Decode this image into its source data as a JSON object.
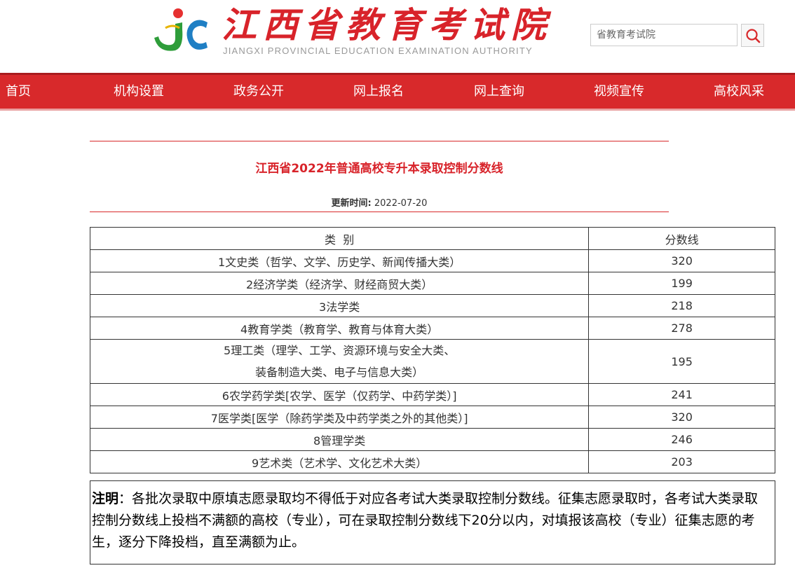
{
  "header": {
    "title_cn": "江西省教育考试院",
    "title_en": "JIANGXI PROVINCIAL EDUCATION EXAMINATION AUTHORITY",
    "logo_icon": "jx-logo-icon",
    "search": {
      "placeholder": "省教育考试院",
      "icon": "search-icon"
    }
  },
  "nav": {
    "items": [
      {
        "label": "首页"
      },
      {
        "label": "机构设置"
      },
      {
        "label": "政务公开"
      },
      {
        "label": "网上报名"
      },
      {
        "label": "网上查询"
      },
      {
        "label": "视频宣传"
      },
      {
        "label": "高校风采"
      }
    ]
  },
  "article": {
    "title": "江西省2022年普通高校专升本录取控制分数线",
    "update_label": "更新时间:",
    "update_date": "2022-07-20"
  },
  "table": {
    "headers": [
      "类  别",
      "分数线"
    ],
    "rows": [
      {
        "category": "1文史类（哲学、文学、历史学、新闻传播大类）",
        "score": "320"
      },
      {
        "category": "2经济学类（经济学、财经商贸大类）",
        "score": "199"
      },
      {
        "category": "3法学类",
        "score": "218"
      },
      {
        "category": "4教育学类（教育学、教育与体育大类）",
        "score": "278"
      },
      {
        "category": "5理工类（理学、工学、资源环境与安全大类、",
        "category_line2": "装备制造大类、电子与信息大类）",
        "score": "195"
      },
      {
        "category": "6农学药学类[农学、医学（仅药学、中药学类）]",
        "score": "241"
      },
      {
        "category": "7医学类[医学（除药学类及中药学类之外的其他类）]",
        "score": "320"
      },
      {
        "category": "8管理学类",
        "score": "246"
      },
      {
        "category": "9艺术类（艺术学、文化艺术大类）",
        "score": "203"
      }
    ]
  },
  "note": {
    "label": "注明",
    "text": "：各批次录取中原填志愿录取均不得低于对应各考试大类录取控制分数线。征集志愿录取时，各考试大类录取控制分数线上投档不满额的高校（专业），可在录取控制分数线下20分以内，对填报该高校（专业）征集志愿的考生，逐分下降投档，直至满额为止。"
  },
  "colors": {
    "brand_red": "#d8292b",
    "title_red": "#d8232a"
  }
}
